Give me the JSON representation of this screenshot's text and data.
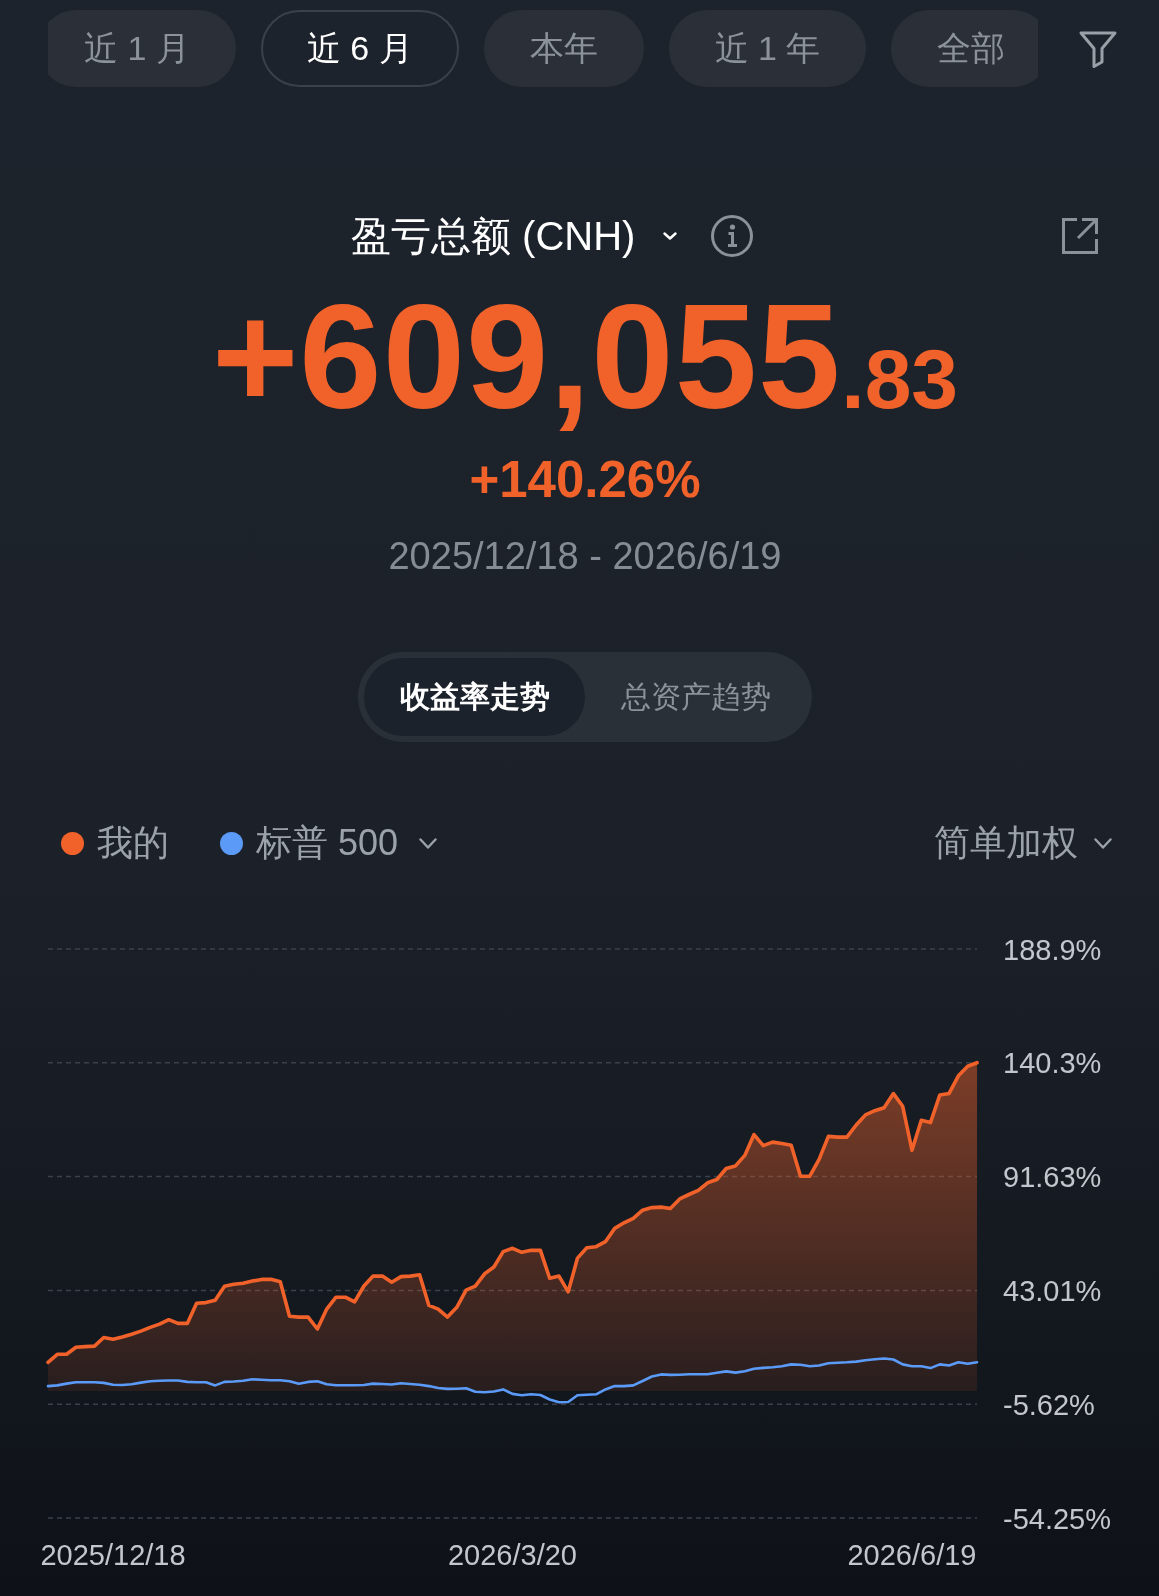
{
  "period_tabs": [
    {
      "label": "近 1 月",
      "selected": false
    },
    {
      "label": "近 6 月",
      "selected": true
    },
    {
      "label": "本年",
      "selected": false
    },
    {
      "label": "近 1 年",
      "selected": false
    },
    {
      "label": "全部",
      "selected": false
    }
  ],
  "summary": {
    "metric": {
      "label": "盈亏总额 (CNH)",
      "menu": true
    },
    "total": {
      "main": "+609,055",
      "fraction": ".83"
    },
    "return": "+140.26%",
    "range": "2025/12/18 - 2026/6/19"
  },
  "view_toggle": [
    {
      "label": "收益率走势",
      "selected": true
    },
    {
      "label": "总资产趋势",
      "selected": false
    }
  ],
  "chart": {
    "legend": [
      {
        "menu": false
      },
      {
        "menu": true
      }
    ],
    "weighting": {
      "label": "简单加权",
      "menu": true
    },
    "chart_data": {
      "type": "area",
      "grid": true,
      "ylim": [
        -54.25,
        188.9
      ],
      "categories": [
        null,
        null,
        null,
        null,
        null,
        null,
        null,
        "2025/12/18",
        null,
        null,
        null,
        null,
        null,
        null,
        null,
        null,
        null,
        null,
        null,
        null,
        null,
        null,
        null,
        null,
        null,
        null,
        null,
        null,
        null,
        null,
        null,
        null,
        null,
        null,
        null,
        null,
        null,
        null,
        null,
        null,
        null,
        null,
        null,
        null,
        null,
        null,
        null,
        null,
        null,
        null,
        "2026/3/20",
        null,
        null,
        null,
        null,
        null,
        null,
        null,
        null,
        null,
        null,
        null,
        null,
        null,
        null,
        null,
        null,
        null,
        null,
        null,
        null,
        null,
        null,
        null,
        null,
        null,
        null,
        null,
        null,
        null,
        null,
        null,
        null,
        null,
        null,
        null,
        null,
        null,
        null,
        null,
        null,
        null,
        null,
        "2026/6/19",
        null,
        null,
        null,
        null,
        null,
        null,
        null
      ],
      "yticks": [
        {
          "value": 188.9,
          "label": "188.9%"
        },
        {
          "value": 140.3,
          "label": "140.3%"
        },
        {
          "value": 91.63,
          "label": "91.63%"
        },
        {
          "value": 43.01,
          "label": "43.01%"
        },
        {
          "value": -5.62,
          "label": "-5.62%"
        },
        {
          "value": -54.25,
          "label": "-54.25%"
        }
      ],
      "series": [
        {
          "name": "我的",
          "color": "#f0622a",
          "values": [
            12.3,
            15.7,
            15.7,
            18.7,
            19.0,
            19.2,
            22.9,
            22.1,
            23.1,
            24.3,
            25.6,
            27.2,
            28.6,
            30.5,
            28.9,
            28.9,
            37.5,
            37.8,
            38.8,
            44.8,
            45.6,
            46.1,
            47.0,
            47.7,
            47.8,
            46.7,
            32.0,
            31.6,
            31.6,
            26.5,
            35.0,
            40.1,
            40.1,
            38.1,
            44.9,
            49.1,
            49.1,
            46.5,
            48.9,
            49.1,
            49.7,
            36.6,
            35.0,
            31.6,
            35.8,
            43.1,
            44.8,
            50.1,
            53.0,
            59.6,
            61.0,
            59.3,
            60.2,
            60.1,
            48.2,
            49.1,
            42.4,
            56.8,
            61.2,
            61.7,
            63.8,
            69.5,
            71.9,
            73.8,
            77.3,
            78.4,
            78.6,
            78.0,
            82.1,
            84.0,
            85.8,
            89.0,
            90.4,
            95.1,
            96.2,
            100.7,
            109.6,
            104.9,
            106.4,
            105.8,
            105.0,
            91.8,
            91.8,
            99.0,
            108.8,
            108.5,
            108.5,
            113.7,
            118.0,
            119.8,
            121.1,
            127.1,
            121.7,
            102.9,
            115.7,
            114.7,
            126.5,
            127.2,
            134.7,
            138.8,
            140.3
          ]
        },
        {
          "name": "标普 500",
          "color": "#5b9bf7",
          "type": "line",
          "values": [
            2.1,
            2.4,
            3.2,
            3.8,
            3.8,
            3.8,
            3.5,
            2.7,
            2.6,
            2.9,
            3.6,
            4.2,
            4.4,
            4.5,
            4.5,
            3.9,
            3.8,
            3.8,
            2.4,
            3.9,
            4.1,
            4.4,
            5.0,
            4.8,
            4.6,
            4.6,
            4.2,
            3.1,
            3.9,
            4.2,
            2.9,
            2.5,
            2.5,
            2.5,
            2.6,
            3.2,
            3.0,
            2.8,
            3.3,
            3.0,
            2.7,
            2.1,
            1.3,
            0.9,
            1.0,
            1.2,
            -0.3,
            -0.5,
            -0.2,
            0.7,
            -1.2,
            -1.8,
            -1.4,
            -1.7,
            -3.6,
            -4.8,
            -4.7,
            -1.8,
            -1.6,
            -1.4,
            0.7,
            2.1,
            2.1,
            2.4,
            4.3,
            6.2,
            7.1,
            6.9,
            7.0,
            7.2,
            7.2,
            7.2,
            7.8,
            8.4,
            7.9,
            8.5,
            9.5,
            9.9,
            10.2,
            10.6,
            11.4,
            11.2,
            10.6,
            10.9,
            11.9,
            12.1,
            12.3,
            12.6,
            13.2,
            13.6,
            13.9,
            13.5,
            11.4,
            10.6,
            10.6,
            9.8,
            11.4,
            10.9,
            12.3,
            11.7,
            12.3
          ]
        }
      ]
    }
  }
}
